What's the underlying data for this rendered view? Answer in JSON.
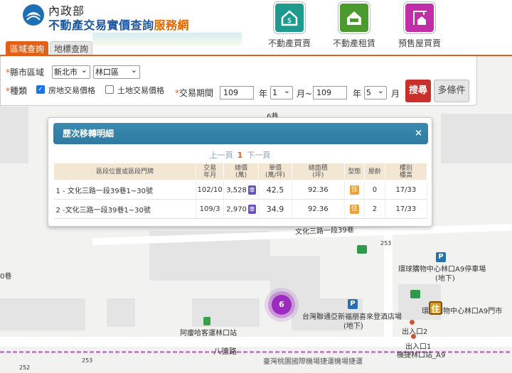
{
  "header": {
    "org_name": "內政部",
    "service_name_main": "不動產交易實價查詢",
    "service_name_accent": "服務網",
    "tabs": [
      {
        "label": "區域查詢",
        "active": true
      },
      {
        "label": "地標查詢",
        "active": false
      }
    ],
    "nav": [
      {
        "label": "不動產買賣",
        "icon": "house-dollar-icon",
        "color": "#1f9a8e"
      },
      {
        "label": "不動產租賃",
        "icon": "house-rent-icon",
        "color": "#4a9a2e"
      },
      {
        "label": "預售屋買賣",
        "icon": "crane-house-icon",
        "color": "#c02ea8"
      }
    ]
  },
  "search": {
    "region_label": "縣市區域",
    "city_value": "新北市",
    "district_value": "林口區",
    "type_label": "種類",
    "type_option_1": "房地交易價格",
    "type_option_1_checked": true,
    "type_option_2": "土地交易價格",
    "type_option_2_checked": false,
    "period_label": "交易期間",
    "start_year": "109",
    "year_unit": "年",
    "start_month": "1",
    "month_to": "月~",
    "end_year": "109",
    "end_month": "5",
    "month_unit": "月",
    "search_button": "搜尋",
    "more_button": "多條件",
    "required_mark": "*"
  },
  "dialog": {
    "title": "歷次移轉明細",
    "close": "×",
    "pager_prev": "上一頁",
    "pager_current": "1",
    "pager_next": "下一頁",
    "columns": {
      "address": "區段位置或區段門牌",
      "date": "交易\n年月",
      "total": "總價\n(萬)",
      "unit": "單價\n(萬/坪)",
      "area": "總面積\n(坪)",
      "type": "型態",
      "age": "屋齡",
      "floor": "樓別\n樓高"
    },
    "rows": [
      {
        "address": "1 - 文化三路一段39巷1~30號",
        "date": "102/10",
        "total": "3,528",
        "parking": "車",
        "unit": "42.5",
        "area": "92.36",
        "type": "住",
        "age": "0",
        "floor": "17/33"
      },
      {
        "address": "2 -文化三路一段39巷1~30號",
        "date": "109/3",
        "total": "2,970",
        "parking": "車",
        "unit": "34.9",
        "area": "92.36",
        "type": "住",
        "age": "2",
        "floor": "17/33"
      }
    ]
  },
  "map": {
    "road_1": "文化三路一段39巷",
    "road_2": "八德路",
    "road_3": "0巷",
    "road_4": "6巷",
    "rail_line": "臺灣桃園國際機場捷運機場捷運",
    "num_253a": "253",
    "num_253b": "253",
    "num_252": "252",
    "parking_1_label": "環球購物中心林口A9停車場",
    "parking_1_sub": "(地下)",
    "parking_2_label": "台灣聯通亞新福朋喜來登酒店場",
    "parking_2_sub": "(地下)",
    "mall_label": "環球購物中心林口A9門市",
    "bus_stop": "阿瘻哈客運林口站",
    "exit_2": "出入口2",
    "exit_1": "出入口1",
    "station": "機捷林口站_A9",
    "cluster_count": "6",
    "marker_type": "住",
    "poi_p": "P",
    "marker_top_label": "住"
  }
}
